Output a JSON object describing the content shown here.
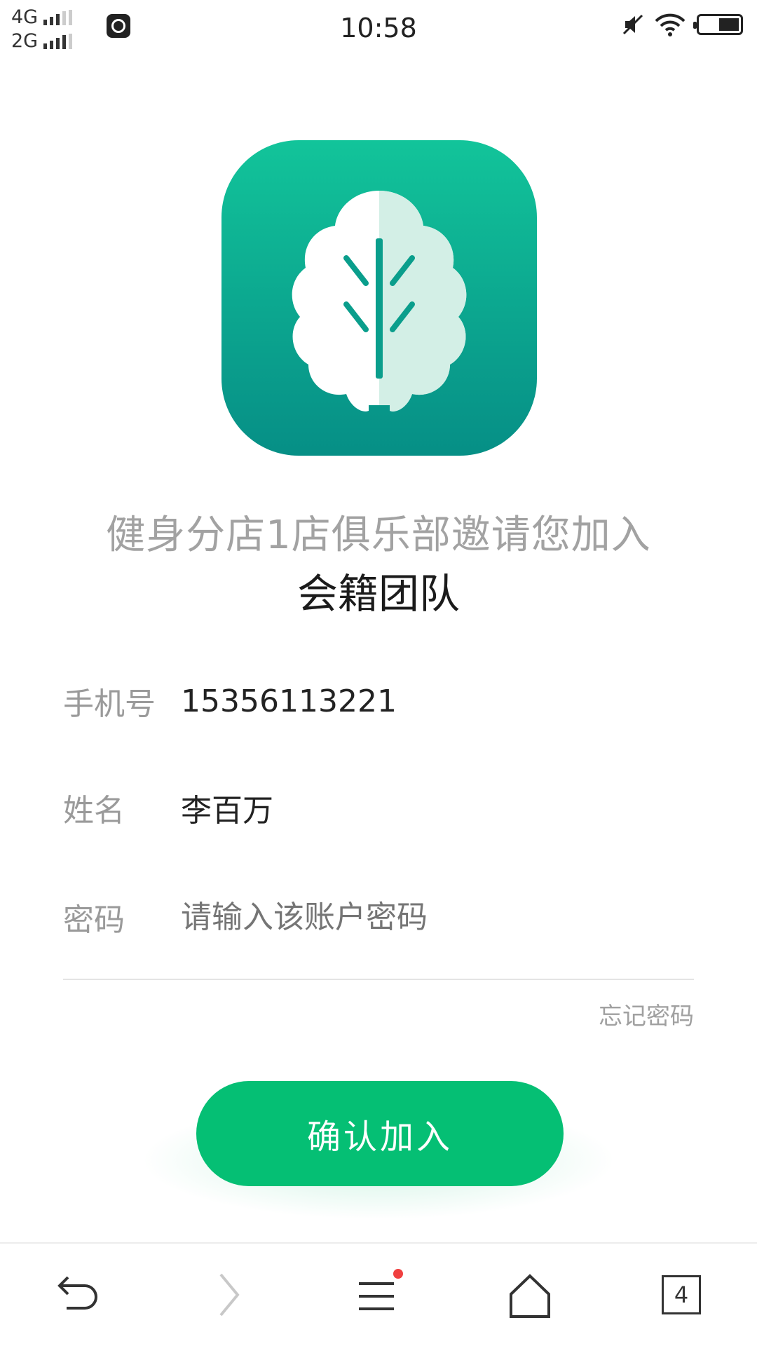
{
  "status_bar": {
    "network_top": "4G",
    "network_bottom": "2G",
    "time": "10:58"
  },
  "invite": {
    "text": "健身分店1店俱乐部邀请您加入",
    "team": "会籍团队"
  },
  "form": {
    "phone_label": "手机号",
    "phone_value": "15356113221",
    "name_label": "姓名",
    "name_value": "李百万",
    "password_label": "密码",
    "password_placeholder": "请输入该账户密码",
    "forgot": "忘记密码"
  },
  "confirm_button": "确认加入",
  "bottom_nav": {
    "tab_count": "4"
  },
  "colors": {
    "accent": "#05bf74",
    "logo_top": "#12c49a",
    "logo_bottom": "#068f86",
    "badge": "#f04040"
  }
}
